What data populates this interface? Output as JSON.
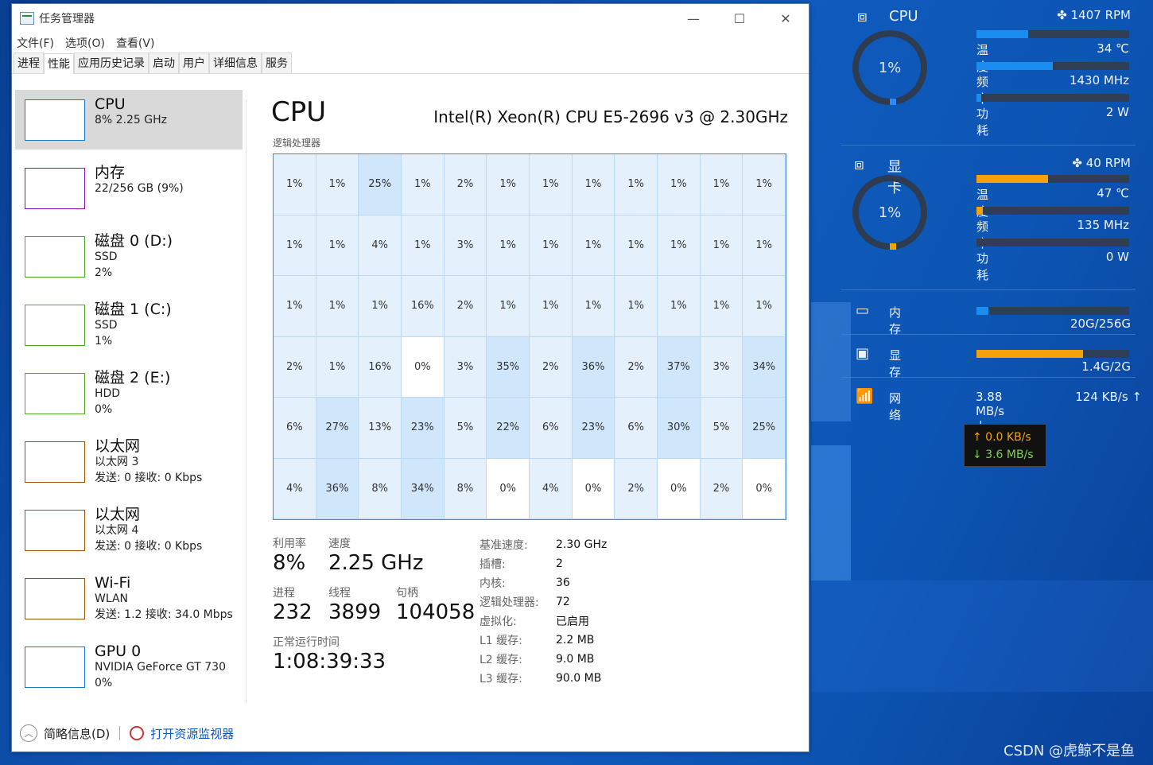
{
  "window": {
    "title": "任务管理器",
    "menu": [
      "文件(F)",
      "选项(O)",
      "查看(V)"
    ],
    "tabs": [
      "进程",
      "性能",
      "应用历史记录",
      "启动",
      "用户",
      "详细信息",
      "服务"
    ]
  },
  "sidebar": {
    "items": [
      {
        "name": "CPU",
        "sub1": "8% 2.25 GHz",
        "sub2": "",
        "color": "#1979ca"
      },
      {
        "name": "内存",
        "sub1": "22/256 GB (9%)",
        "sub2": "",
        "color": "#8b12ae"
      },
      {
        "name": "磁盘 0 (D:)",
        "sub1": "SSD",
        "sub2": "2%",
        "color": "#4ca81c"
      },
      {
        "name": "磁盘 1 (C:)",
        "sub1": "SSD",
        "sub2": "1%",
        "color": "#4ca81c"
      },
      {
        "name": "磁盘 2 (E:)",
        "sub1": "HDD",
        "sub2": "0%",
        "color": "#4ca81c"
      },
      {
        "name": "以太网",
        "sub1": "以太网 3",
        "sub2": "发送: 0 接收: 0 Kbps",
        "color": "#a74f01"
      },
      {
        "name": "以太网",
        "sub1": "以太网 4",
        "sub2": "发送: 0 接收: 0 Kbps",
        "color": "#a74f01"
      },
      {
        "name": "Wi-Fi",
        "sub1": "WLAN",
        "sub2": "发送: 1.2 接收: 34.0 Mbps",
        "color": "#a74f01"
      },
      {
        "name": "GPU 0",
        "sub1": "NVIDIA GeForce GT 730",
        "sub2": "0%",
        "color": "#1979ca"
      }
    ]
  },
  "main": {
    "title": "CPU",
    "model": "Intel(R) Xeon(R) CPU E5-2696 v3 @ 2.30GHz",
    "lp_label": "逻辑处理器",
    "cores": [
      1,
      1,
      25,
      1,
      2,
      1,
      1,
      1,
      1,
      1,
      1,
      1,
      1,
      1,
      4,
      1,
      3,
      1,
      1,
      1,
      1,
      1,
      1,
      1,
      1,
      1,
      1,
      16,
      2,
      1,
      1,
      1,
      1,
      1,
      1,
      1,
      2,
      1,
      16,
      0,
      3,
      35,
      2,
      36,
      2,
      37,
      3,
      34,
      6,
      27,
      13,
      23,
      5,
      22,
      6,
      23,
      6,
      30,
      5,
      25,
      4,
      36,
      8,
      34,
      8,
      0,
      4,
      0,
      2,
      0,
      2,
      0
    ]
  },
  "stats": {
    "util_label": "利用率",
    "util": "8%",
    "speed_label": "速度",
    "speed": "2.25 GHz",
    "proc_label": "进程",
    "proc": "232",
    "thread_label": "线程",
    "thread": "3899",
    "handle_label": "句柄",
    "handle": "104058",
    "uptime_label": "正常运行时间",
    "uptime": "1:08:39:33"
  },
  "specs": [
    {
      "k": "基准速度:",
      "v": "2.30 GHz"
    },
    {
      "k": "插槽:",
      "v": "2"
    },
    {
      "k": "内核:",
      "v": "36"
    },
    {
      "k": "逻辑处理器:",
      "v": "72"
    },
    {
      "k": "虚拟化:",
      "v": "已启用"
    },
    {
      "k": "L1 缓存:",
      "v": "2.2 MB"
    },
    {
      "k": "L2 缓存:",
      "v": "9.0 MB"
    },
    {
      "k": "L3 缓存:",
      "v": "90.0 MB"
    }
  ],
  "footer": {
    "summary": "简略信息(D)",
    "monitor": "打开资源监视器"
  },
  "gadget": {
    "cpu": {
      "label": "CPU",
      "pct": "1%",
      "fan": "1407 RPM",
      "temp_label": "温度",
      "temp": "34 ℃",
      "freq_label": "频率",
      "freq": "1430 MHz",
      "power_label": "功耗",
      "power": "2 W",
      "temp_fill": 0.34,
      "freq_fill": 0.5,
      "power_fill": 0.01
    },
    "gpu": {
      "label": "显卡",
      "pct": "1%",
      "fan": "40 RPM",
      "temp_label": "温度",
      "temp": "47 ℃",
      "freq_label": "频率",
      "freq": "135 MHz",
      "power_label": "功耗",
      "power": "0 W",
      "temp_fill": 0.47,
      "freq_fill": 0.04,
      "power_fill": 0.0
    },
    "mem": {
      "label": "内 存",
      "value": "20G/256G",
      "fill": 0.08
    },
    "vram": {
      "label": "显 存",
      "value": "1.4G/2G",
      "fill": 0.7
    },
    "net": {
      "label": "网 络",
      "down": "3.88 MB/s ↓",
      "up": "124 KB/s ↑"
    },
    "tooltip": {
      "up": "↑ 0.0 KB/s",
      "down": "↓ 3.6 MB/s"
    },
    "accent_blue": "#1a8ef0",
    "accent_orange": "#f5a20a"
  },
  "watermark": "CSDN @虎鲸不是鱼"
}
